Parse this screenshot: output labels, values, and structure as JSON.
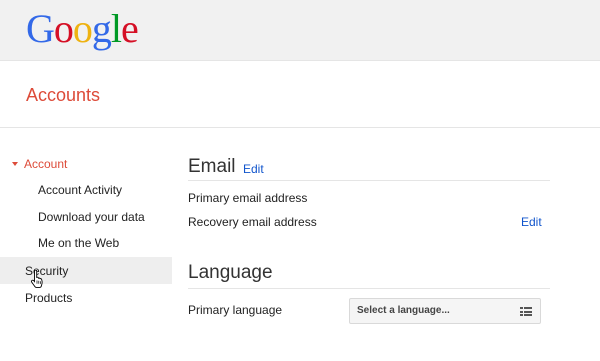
{
  "header": {
    "logo": {
      "letters": [
        "G",
        "o",
        "o",
        "g",
        "l",
        "e"
      ],
      "colors": [
        "#3369e8",
        "#d50f25",
        "#eeb211",
        "#3369e8",
        "#009925",
        "#d50f25"
      ]
    },
    "accent_color": "#dd4b39",
    "link_color": "#1155cc"
  },
  "accounts_bar": {
    "title": "Accounts"
  },
  "sidebar": {
    "account": "Account",
    "items": [
      {
        "label": "Account Activity"
      },
      {
        "label": "Download your data"
      },
      {
        "label": "Me on the Web"
      },
      {
        "label": "Security"
      },
      {
        "label": "Products"
      }
    ],
    "hovered_item": "Security"
  },
  "main": {
    "email": {
      "title": "Email",
      "edit_label": "Edit",
      "primary_label": "Primary email address",
      "recovery_label": "Recovery email address",
      "recovery_edit_label": "Edit"
    },
    "language": {
      "title": "Language",
      "primary_label": "Primary language",
      "select_placeholder": "Select a language..."
    }
  }
}
